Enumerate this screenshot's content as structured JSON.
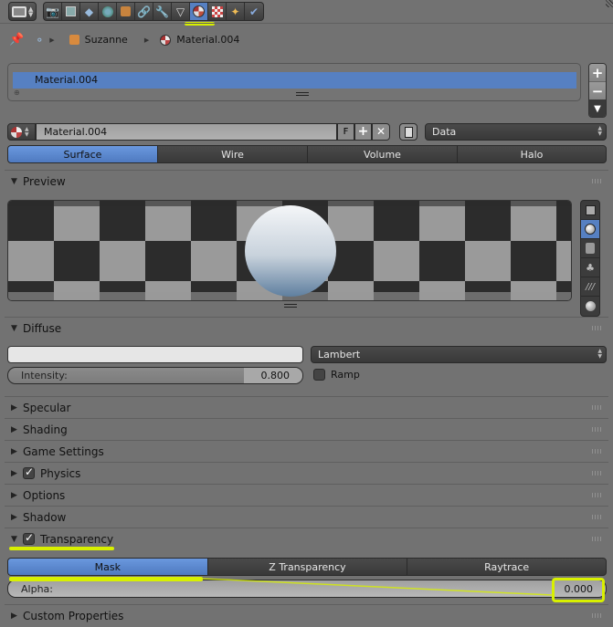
{
  "toolbar": {
    "editor_type_icon": "properties-editor-icon",
    "tabs": [
      {
        "icon": "render-icon",
        "label": "Render"
      },
      {
        "icon": "render-layers-icon",
        "label": "Render Layers"
      },
      {
        "icon": "scene-icon",
        "label": "Scene"
      },
      {
        "icon": "world-icon",
        "label": "World"
      },
      {
        "icon": "object-icon",
        "label": "Object"
      },
      {
        "icon": "constraints-icon",
        "label": "Constraints"
      },
      {
        "icon": "modifiers-icon",
        "label": "Modifiers"
      },
      {
        "icon": "mesh-data-icon",
        "label": "Data"
      },
      {
        "icon": "material-icon",
        "label": "Material",
        "active": true
      },
      {
        "icon": "texture-icon",
        "label": "Texture"
      },
      {
        "icon": "particles-icon",
        "label": "Particles"
      },
      {
        "icon": "physics-icon",
        "label": "Physics"
      }
    ]
  },
  "breadcrumb": {
    "items": [
      "Suzanne",
      "Material.004"
    ]
  },
  "material_slots": {
    "items": [
      "Material.004"
    ]
  },
  "datablock": {
    "name": "Material.004",
    "fake_user_label": "F",
    "link_mode": "Data"
  },
  "type_tabs": [
    "Surface",
    "Wire",
    "Volume",
    "Halo"
  ],
  "type_selected": "Surface",
  "colors": {
    "accent": "#5680c2",
    "highlight": "#d8f000",
    "background": "#727272",
    "diffuse_color": "#e6e6e6"
  },
  "panels": {
    "preview": {
      "title": "Preview",
      "expanded": true
    },
    "diffuse": {
      "title": "Diffuse",
      "shader": "Lambert",
      "intensity_label": "Intensity:",
      "intensity_value": "0.800",
      "ramp_label": "Ramp"
    },
    "specular": {
      "title": "Specular"
    },
    "shading": {
      "title": "Shading"
    },
    "game_settings": {
      "title": "Game Settings"
    },
    "physics": {
      "title": "Physics",
      "checked": true
    },
    "options": {
      "title": "Options"
    },
    "shadow": {
      "title": "Shadow"
    },
    "transparency": {
      "title": "Transparency",
      "checked": true,
      "methods": [
        "Mask",
        "Z Transparency",
        "Raytrace"
      ],
      "selected": "Mask",
      "alpha_label": "Alpha:",
      "alpha_value": "0.000"
    },
    "custom_properties": {
      "title": "Custom Properties"
    }
  }
}
